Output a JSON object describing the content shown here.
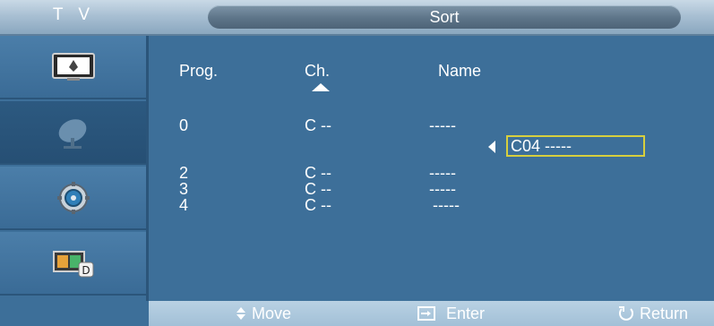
{
  "header": {
    "tv_label": "T V",
    "title": "Sort"
  },
  "sidebar": {
    "items": [
      {
        "icon": "picture-icon",
        "selected": false
      },
      {
        "icon": "satellite-dish-icon",
        "selected": true
      },
      {
        "icon": "setup-gear-icon",
        "selected": false
      },
      {
        "icon": "input-source-icon",
        "selected": false
      }
    ]
  },
  "table": {
    "headers": {
      "prog": "Prog.",
      "ch": "Ch.",
      "name": "Name"
    },
    "sort_column": "Ch.",
    "rows": [
      {
        "prog": "0",
        "ch": "C --",
        "name": "-----"
      },
      {
        "prog": "2",
        "ch": "C --",
        "name": "-----"
      },
      {
        "prog": "3",
        "ch": "C --",
        "name": "-----"
      },
      {
        "prog": "4",
        "ch": "C --",
        "name": "-----"
      }
    ],
    "editing": {
      "value": "C04 -----"
    }
  },
  "footer": {
    "move": "Move",
    "enter": "Enter",
    "return": "Return"
  },
  "colors": {
    "highlight": "#d7cf3e",
    "background": "#3d6f99"
  }
}
